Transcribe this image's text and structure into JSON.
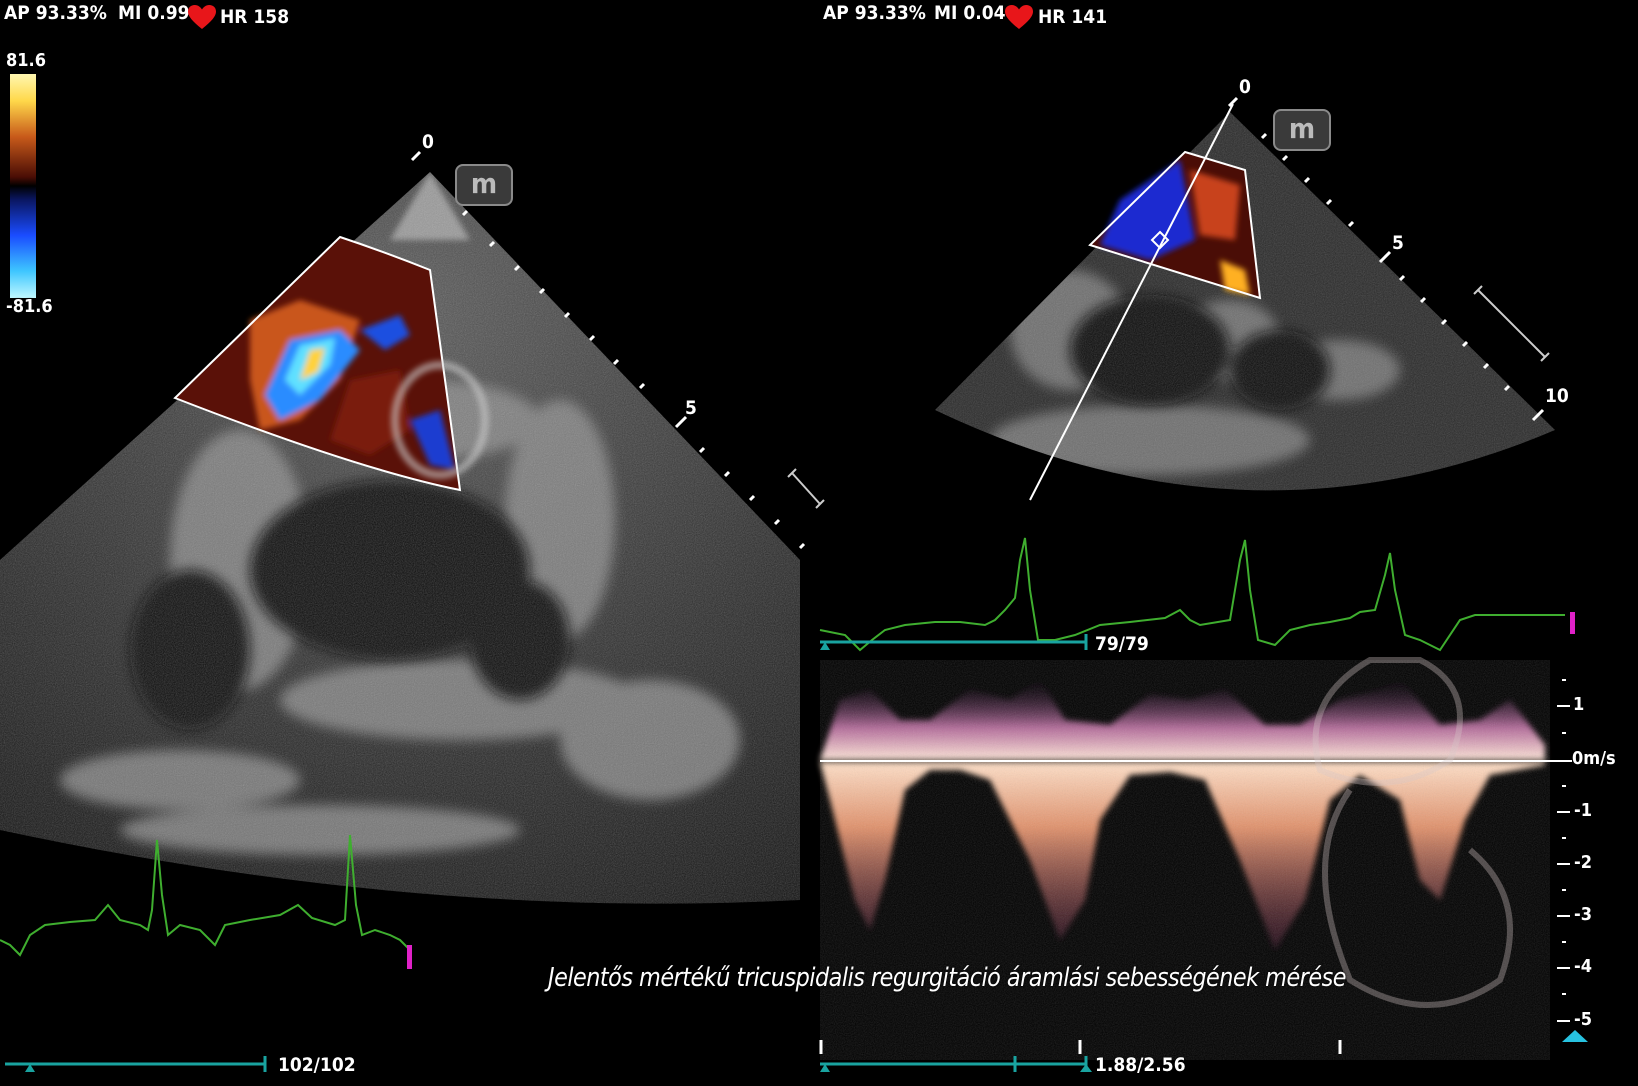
{
  "left_panel": {
    "ap": "AP 93.33%",
    "mi": "MI 0.99",
    "hr": "HR 158",
    "scale_max": "81.6",
    "scale_min": "-81.6",
    "depth_0": "0",
    "depth_5": "5",
    "frame_counter": "102/102"
  },
  "right_panel": {
    "ap": "AP 93.33%",
    "mi": "MI 0.04",
    "hr": "HR 141",
    "depth_0": "0",
    "depth_5": "5",
    "depth_10": "10",
    "frame_counter": "79/79",
    "time_counter": "1.88/2.56"
  },
  "doppler_axis": {
    "ticks": [
      "1",
      "0m/s",
      "-1",
      "-2",
      "-3",
      "-4",
      "-5"
    ]
  },
  "caption": "Jelentős mértékű tricuspidalis regurgitáció áramlási sebességének mérése",
  "colors": {
    "ecg": "#3fae2f",
    "teal": "#19a3a0",
    "heart": "#e8161a",
    "marker": "#e021c8"
  }
}
